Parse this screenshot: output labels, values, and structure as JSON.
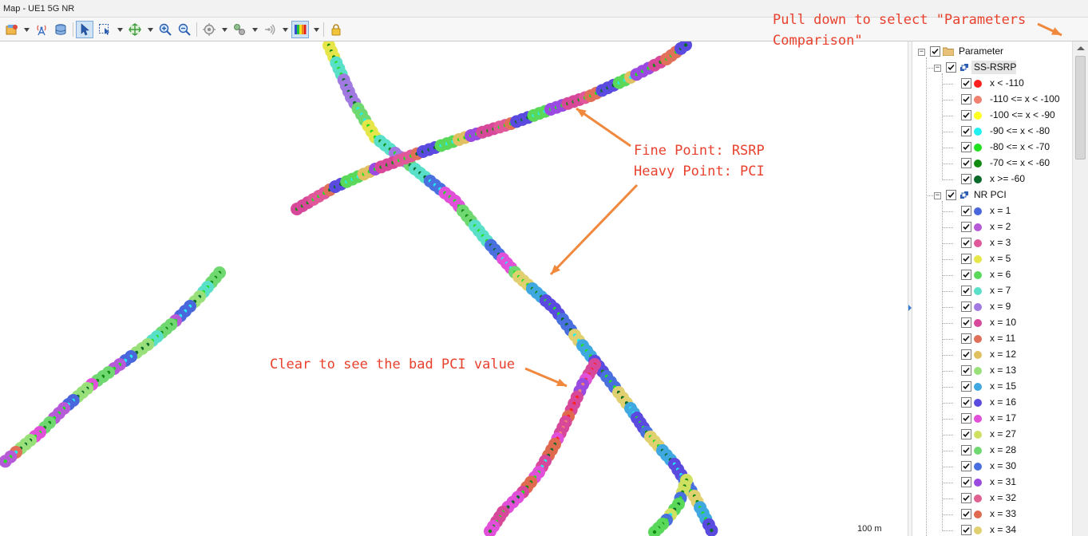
{
  "window": {
    "title": "Map - UE1 5G NR"
  },
  "toolbar": {
    "buttons": [
      {
        "name": "layer-manager-icon",
        "dropdown": true
      },
      {
        "name": "base-station-icon",
        "dropdown": false
      },
      {
        "name": "database-icon",
        "dropdown": false
      },
      {
        "name": "select-arrow-icon",
        "dropdown": false,
        "active": true
      },
      {
        "name": "select-region-icon",
        "dropdown": true
      },
      {
        "name": "pan-map-icon",
        "dropdown": true
      },
      {
        "name": "zoom-in-icon",
        "dropdown": false
      },
      {
        "name": "zoom-out-icon",
        "dropdown": false
      },
      {
        "name": "locate-target-icon",
        "dropdown": true
      },
      {
        "name": "route-icon",
        "dropdown": true
      },
      {
        "name": "signal-icon",
        "dropdown": true
      },
      {
        "name": "legend-colors-icon",
        "dropdown": true,
        "active": true
      },
      {
        "name": "lock-icon",
        "dropdown": false
      }
    ],
    "collapse_icon": "chevron-down-icon"
  },
  "annotations": {
    "pulldown": "Pull down to select \"Parameters\nComparison\"",
    "points": "Fine Point: RSRP\nHeavy Point: PCI",
    "bad_pci": "Clear to see the bad PCI value",
    "color": "#e8412d",
    "arrow_color": "#f0883e"
  },
  "map": {
    "scale_label": "100 m"
  },
  "legend": {
    "root": "Parameter",
    "groups": [
      {
        "name": "SS-RSRP",
        "items": [
          {
            "label": "x < -110",
            "color": "#ff2020"
          },
          {
            "label": "-110 <= x < -100",
            "color": "#f08070"
          },
          {
            "label": "-100 <= x < -90",
            "color": "#ffff20"
          },
          {
            "label": "-90 <= x < -80",
            "color": "#20f0f0"
          },
          {
            "label": "-80 <= x < -70",
            "color": "#20e020"
          },
          {
            "label": "-70 <= x < -60",
            "color": "#108a10"
          },
          {
            "label": "x >= -60",
            "color": "#0a6a2a"
          }
        ]
      },
      {
        "name": "NR PCI",
        "items": [
          {
            "label": "x = 1",
            "color": "#4a66dd"
          },
          {
            "label": "x = 2",
            "color": "#b65ad8"
          },
          {
            "label": "x = 3",
            "color": "#e0589a"
          },
          {
            "label": "x = 5",
            "color": "#e6e64a"
          },
          {
            "label": "x = 6",
            "color": "#5ad85a"
          },
          {
            "label": "x = 7",
            "color": "#5ae0c8"
          },
          {
            "label": "x = 9",
            "color": "#a07ae0"
          },
          {
            "label": "x = 10",
            "color": "#d8489a"
          },
          {
            "label": "x = 11",
            "color": "#e0705a"
          },
          {
            "label": "x = 12",
            "color": "#e0c060"
          },
          {
            "label": "x = 13",
            "color": "#9ae07a"
          },
          {
            "label": "x = 15",
            "color": "#40a8e0"
          },
          {
            "label": "x = 16",
            "color": "#5a4ae0"
          },
          {
            "label": "x = 17",
            "color": "#e050d8"
          },
          {
            "label": "x = 27",
            "color": "#d0e060"
          },
          {
            "label": "x = 28",
            "color": "#70d870"
          },
          {
            "label": "x = 30",
            "color": "#4a70e0"
          },
          {
            "label": "x = 31",
            "color": "#9a4ae0"
          },
          {
            "label": "x = 32",
            "color": "#e06090"
          },
          {
            "label": "x = 33",
            "color": "#e06a50"
          },
          {
            "label": "x = 34",
            "color": "#e0d070"
          }
        ]
      }
    ]
  }
}
